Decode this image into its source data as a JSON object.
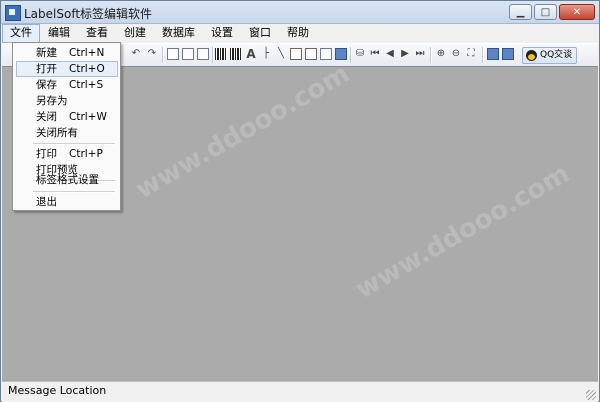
{
  "window": {
    "title": "LabelSoft标签编辑软件"
  },
  "titlebar": {
    "minimize": "▁",
    "maximize": "□",
    "close": "✕"
  },
  "menubar": {
    "items": [
      {
        "label": "文件"
      },
      {
        "label": "编辑"
      },
      {
        "label": "查看"
      },
      {
        "label": "创建"
      },
      {
        "label": "数据库"
      },
      {
        "label": "设置"
      },
      {
        "label": "窗口"
      },
      {
        "label": "帮助"
      }
    ]
  },
  "file_menu": {
    "items": [
      {
        "label": "新建",
        "shortcut": "Ctrl+N"
      },
      {
        "label": "打开",
        "shortcut": "Ctrl+O"
      },
      {
        "label": "保存",
        "shortcut": "Ctrl+S"
      },
      {
        "label": "另存为",
        "shortcut": ""
      },
      {
        "label": "关闭",
        "shortcut": "Ctrl+W"
      },
      {
        "label": "关闭所有",
        "shortcut": ""
      },
      {
        "label": "打印",
        "shortcut": "Ctrl+P"
      },
      {
        "label": "打印预览",
        "shortcut": ""
      },
      {
        "label": "标签格式设置",
        "shortcut": ""
      },
      {
        "label": "退出",
        "shortcut": ""
      }
    ]
  },
  "toolbar": {
    "glyphs": {
      "undo": "↶",
      "redo": "↷",
      "text": "A",
      "first": "⏮",
      "prev": "◀",
      "next": "▶",
      "last": "⏭",
      "zoom_in": "⊕",
      "zoom_out": "⊖",
      "fit": "⛶"
    },
    "qq_label": "QQ交谈"
  },
  "statusbar": {
    "text": "Message  Location"
  },
  "watermark": {
    "text": "www.ddooo.com"
  },
  "colors": {
    "workspace": "#ababab",
    "menu_highlight": "#e8f0fc",
    "title_gradient": "#dbe6f4"
  }
}
